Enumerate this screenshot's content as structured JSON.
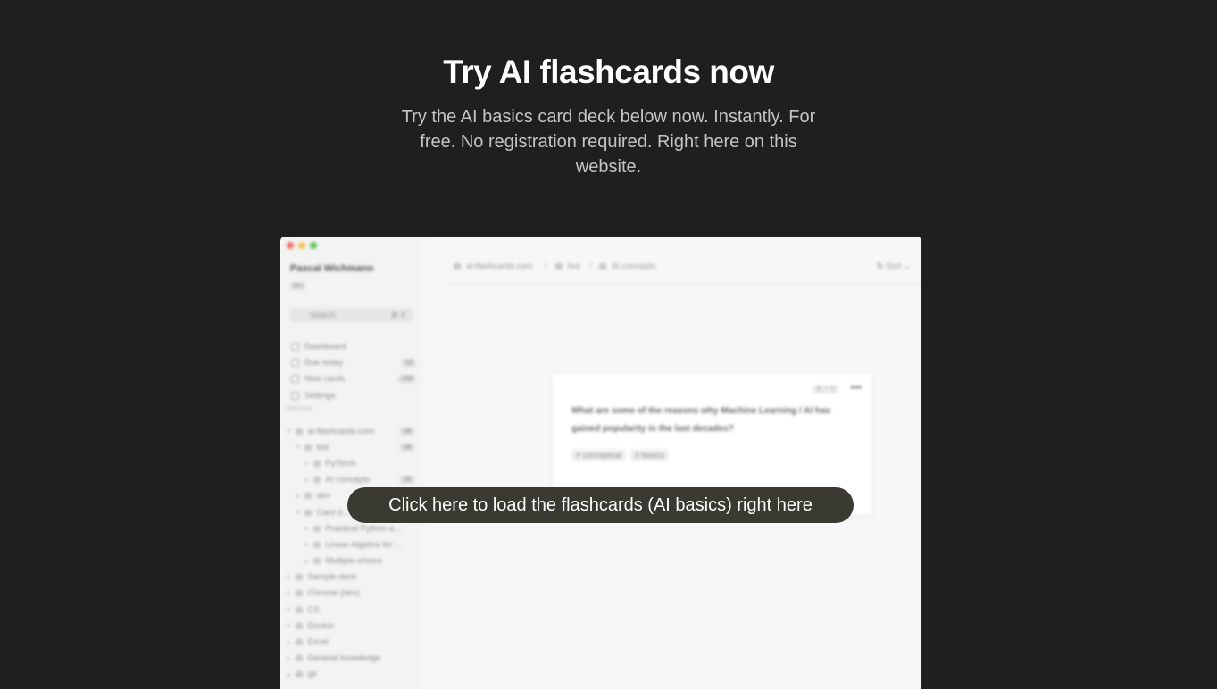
{
  "hero": {
    "title": "Try AI flashcards now",
    "subtitle": "Try the AI basics card deck below now. Instantly. For free. No registration required. Right here on this website."
  },
  "preview": {
    "profile": {
      "name": "Pascal Wichmann",
      "badge": "dev"
    },
    "search": {
      "placeholder": "Search",
      "shortcut": "⌘ K"
    },
    "nav": [
      {
        "label": "Dashboard",
        "icon": "chart-icon",
        "count": ""
      },
      {
        "label": "Due today",
        "icon": "inbox-icon",
        "count": "12"
      },
      {
        "label": "New cards",
        "icon": "circle-icon",
        "count": "248"
      },
      {
        "label": "Settings",
        "icon": "gear-icon",
        "count": ""
      }
    ],
    "decks_heading": "DECKS",
    "decks": [
      {
        "label": "ai-flashcards.com",
        "indent": 0,
        "expanded": true,
        "count": "18"
      },
      {
        "label": "live",
        "indent": 1,
        "expanded": true,
        "count": "18"
      },
      {
        "label": "PyTorch",
        "indent": 2,
        "expanded": false,
        "count": ""
      },
      {
        "label": "AI concepts",
        "indent": 2,
        "expanded": false,
        "count": "18"
      },
      {
        "label": "dev",
        "indent": 1,
        "expanded": false,
        "count": ""
      },
      {
        "label": "Card d...",
        "indent": 1,
        "expanded": true,
        "count": ""
      },
      {
        "label": "Practical Python a...",
        "indent": 2,
        "expanded": false,
        "count": ""
      },
      {
        "label": "Linear Algebra for ...",
        "indent": 2,
        "expanded": false,
        "count": ""
      },
      {
        "label": "Multiple-choice",
        "indent": 2,
        "expanded": false,
        "count": ""
      },
      {
        "label": "Sample deck",
        "indent": 0,
        "expanded": false,
        "count": ""
      },
      {
        "label": "Chrome (dev)",
        "indent": 0,
        "expanded": false,
        "count": ""
      },
      {
        "label": "CS",
        "indent": 0,
        "expanded": false,
        "count": ""
      },
      {
        "label": "Docker",
        "indent": 0,
        "expanded": false,
        "count": ""
      },
      {
        "label": "Excel",
        "indent": 0,
        "expanded": false,
        "count": ""
      },
      {
        "label": "General knowledge",
        "indent": 0,
        "expanded": false,
        "count": ""
      },
      {
        "label": "git",
        "indent": 0,
        "expanded": false,
        "count": ""
      }
    ],
    "breadcrumb": [
      "ai-flashcards.com",
      "live",
      "AI concepts"
    ],
    "sort_label": "Sort",
    "card": {
      "shortcut": "⌘ ⇧ E",
      "question": "What are some of the reasons why Machine Learning / AI has gained popularity in the last decades?",
      "tags": [
        "# conceptual",
        "# basics"
      ]
    }
  },
  "load_button": "Click here to load the flashcards (AI basics) right here"
}
